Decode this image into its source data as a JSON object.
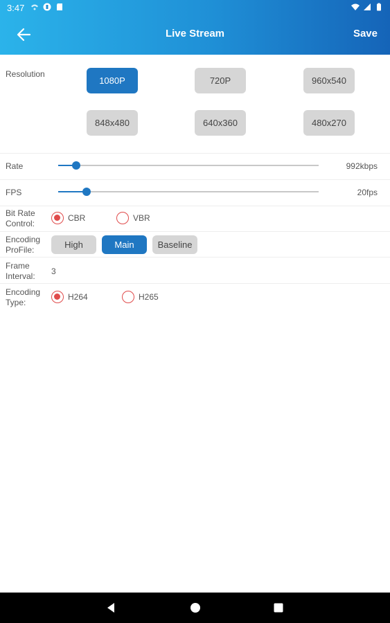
{
  "status_bar": {
    "time": "3:47"
  },
  "toolbar": {
    "title": "Live Stream",
    "save_label": "Save"
  },
  "resolution": {
    "label": "Resolution",
    "options": [
      "1080P",
      "720P",
      "960x540",
      "848x480",
      "640x360",
      "480x270"
    ],
    "selected": "1080P"
  },
  "rate": {
    "label": "Rate",
    "value_text": "992kbps",
    "fraction": 0.07
  },
  "fps": {
    "label": "FPS",
    "value_text": "20fps",
    "fraction": 0.11
  },
  "bit_rate_control": {
    "label_line1": "Bit Rate",
    "label_line2": "Control:",
    "options": [
      "CBR",
      "VBR"
    ],
    "selected": "CBR"
  },
  "encoding_profile": {
    "label_line1": "Encoding",
    "label_line2": "ProFile:",
    "options": [
      "High",
      "Main",
      "Baseline"
    ],
    "selected": "Main"
  },
  "frame_interval": {
    "label_line1": "Frame",
    "label_line2": "Interval:",
    "value": "3"
  },
  "encoding_type": {
    "label_line1": "Encoding",
    "label_line2": "Type:",
    "options": [
      "H264",
      "H265"
    ],
    "selected": "H264"
  },
  "colors": {
    "accent": "#1f77c2",
    "radio": "#e04b4b",
    "header_start": "#2bb3ea",
    "header_end": "#1564b8"
  }
}
